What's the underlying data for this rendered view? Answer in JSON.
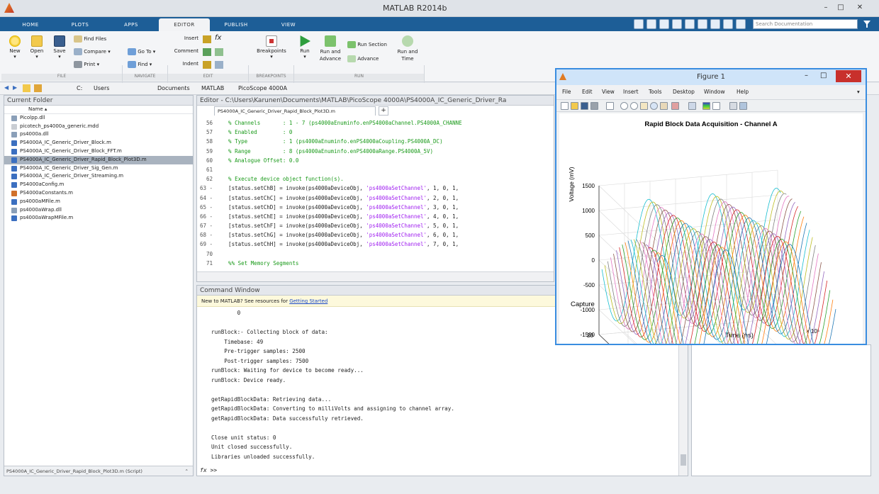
{
  "window": {
    "title": "MATLAB R2014b"
  },
  "tabs": [
    {
      "label": "HOME",
      "active": false
    },
    {
      "label": "PLOTS",
      "active": false
    },
    {
      "label": "APPS",
      "active": false
    },
    {
      "label": "EDITOR",
      "active": true
    },
    {
      "label": "PUBLISH",
      "active": false
    },
    {
      "label": "VIEW",
      "active": false
    }
  ],
  "search": {
    "placeholder": "Search Documentation"
  },
  "ribbon": {
    "new": "New",
    "open": "Open",
    "save": "Save",
    "find_files": "Find Files",
    "compare": "Compare",
    "print": "Print",
    "go_to": "Go To",
    "find": "Find",
    "insert": "Insert",
    "comment": "Comment",
    "indent": "Indent",
    "breakpoints": "Breakpoints",
    "run": "Run",
    "run_and_advance": "Run and Advance",
    "run_section": "Run Section",
    "advance": "Advance",
    "run_and_time": "Run and Time",
    "groups": {
      "file": "FILE",
      "navigate": "NAVIGATE",
      "edit": "EDIT",
      "breakpoints": "BREAKPOINTS",
      "run": "RUN"
    }
  },
  "address": {
    "parts": [
      "C:",
      "Users",
      "Documents",
      "MATLAB",
      "PicoScope 4000A"
    ]
  },
  "folder": {
    "title": "Current Folder",
    "column": "Name",
    "files": [
      {
        "name": "Picolpp.dll",
        "color": "#8a9fb8"
      },
      {
        "name": "picotech_ps4000a_generic.mdd",
        "color": "#c9cdd3"
      },
      {
        "name": "ps4000a.dll",
        "color": "#8a9fb8"
      },
      {
        "name": "PS4000A_IC_Generic_Driver_Block.m",
        "color": "#3b6fc0"
      },
      {
        "name": "PS4000A_IC_Generic_Driver_Block_FFT.m",
        "color": "#3b6fc0"
      },
      {
        "name": "PS4000A_IC_Generic_Driver_Rapid_Block_Plot3D.m",
        "color": "#3b6fc0",
        "selected": true
      },
      {
        "name": "PS4000A_IC_Generic_Driver_Sig_Gen.m",
        "color": "#3b6fc0"
      },
      {
        "name": "PS4000A_IC_Generic_Driver_Streaming.m",
        "color": "#3b6fc0"
      },
      {
        "name": "PS4000aConfig.m",
        "color": "#3b6fc0"
      },
      {
        "name": "PS4000aConstants.m",
        "color": "#d0702a"
      },
      {
        "name": "ps4000aMFile.m",
        "color": "#3b6fc0"
      },
      {
        "name": "ps4000aWrap.dll",
        "color": "#8a9fb8"
      },
      {
        "name": "ps4000aWrapMFile.m",
        "color": "#3b6fc0"
      }
    ],
    "footer": "PS4000A_IC_Generic_Driver_Rapid_Block_Plot3D.m (Script)"
  },
  "editor": {
    "title": "Editor - C:\\Users\\Karunen\\Documents\\MATLAB\\PicoScope 4000A\\PS4000A_IC_Generic_Driver_Ra",
    "tab": "PS4000A_IC_Generic_Driver_Rapid_Block_Plot3D.m",
    "lines": [
      {
        "n": "56",
        "t": "    % Channels       : 1 - 7 (ps4000aEnuminfo.enPS4000aChannel.PS4000A_CHANNE",
        "c": "cm"
      },
      {
        "n": "57",
        "t": "    % Enabled        : 0",
        "c": "cm"
      },
      {
        "n": "58",
        "t": "    % Type           : 1 (ps4000aEnuminfo.enPS4000aCoupling.PS4000A_DC)",
        "c": "cm"
      },
      {
        "n": "59",
        "t": "    % Range          : 8 (ps4000aEnuminfo.enPS4000aRange.PS4000A_5V)",
        "c": "cm"
      },
      {
        "n": "60",
        "t": "    % Analogue Offset: 0.0",
        "c": "cm"
      },
      {
        "n": "61",
        "t": "",
        "c": ""
      },
      {
        "n": "62",
        "t": "    % Execute device object function(s).",
        "c": "cm"
      },
      {
        "n": "63 -",
        "t": "    [status.setChB] = invoke(ps4000aDeviceObj, ",
        "s": "'ps4000aSetChannel'",
        "e": ", 1, 0, 1,"
      },
      {
        "n": "64 -",
        "t": "    [status.setChC] = invoke(ps4000aDeviceObj, ",
        "s": "'ps4000aSetChannel'",
        "e": ", 2, 0, 1,"
      },
      {
        "n": "65 -",
        "t": "    [status.setChD] = invoke(ps4000aDeviceObj, ",
        "s": "'ps4000aSetChannel'",
        "e": ", 3, 0, 1,"
      },
      {
        "n": "66 -",
        "t": "    [status.setChE] = invoke(ps4000aDeviceObj, ",
        "s": "'ps4000aSetChannel'",
        "e": ", 4, 0, 1,"
      },
      {
        "n": "67 -",
        "t": "    [status.setChF] = invoke(ps4000aDeviceObj, ",
        "s": "'ps4000aSetChannel'",
        "e": ", 5, 0, 1,"
      },
      {
        "n": "68 -",
        "t": "    [status.setChG] = invoke(ps4000aDeviceObj, ",
        "s": "'ps4000aSetChannel'",
        "e": ", 6, 0, 1,"
      },
      {
        "n": "69 -",
        "t": "    [status.setChH] = invoke(ps4000aDeviceObj, ",
        "s": "'ps4000aSetChannel'",
        "e": ", 7, 0, 1,"
      },
      {
        "n": "70",
        "t": "",
        "c": ""
      },
      {
        "n": "71",
        "t": "    %% Set Memory Segments",
        "c": "cm"
      }
    ]
  },
  "command": {
    "title": "Command Window",
    "notice": "New to MATLAB? See resources for ",
    "notice_link": "Getting Started",
    "lines": [
      "        0",
      "",
      "runBlock:- Collecting block of data:",
      "    Timebase: 49",
      "    Pre-trigger samples: 2500",
      "    Post-trigger samples: 7500",
      "runBlock: Waiting for device to become ready...",
      "runBlock: Device ready.",
      "",
      "getRapidBlockData: Retrieving data...",
      "getRapidBlockData: Converting to milliVolts and assigning to channel array.",
      "getRapidBlockData: Data successfully retrieved.",
      "",
      "Close unit status: 0",
      "Unit closed successfully.",
      "Libraries unloaded successfully."
    ],
    "prompt": ">>"
  },
  "figure": {
    "title": "Figure 1",
    "menu": [
      "File",
      "Edit",
      "View",
      "Insert",
      "Tools",
      "Desktop",
      "Window",
      "Help"
    ]
  },
  "chart_data": {
    "type": "line",
    "title": "Rapid Block Data Acquisition - Channel A",
    "xlabel": "Time (ns)",
    "ylabel": "Capture",
    "zlabel": "Voltage (mV)",
    "x_ticks": [
      "0",
      "1",
      "2",
      "3",
      "4",
      "5",
      "6",
      "7"
    ],
    "x_exponent": "× 10⁵",
    "y_ticks": [
      "0",
      "10",
      "20"
    ],
    "z_ticks": [
      "1500",
      "1000",
      "500",
      "0",
      "-500",
      "-1000",
      "-1500"
    ],
    "xlim": [
      0,
      7
    ],
    "ylim": [
      0,
      20
    ],
    "zlim": [
      -1500,
      1500
    ],
    "captures": 20,
    "amplitude_mV": 1200,
    "period": 2.5,
    "grid": true
  }
}
